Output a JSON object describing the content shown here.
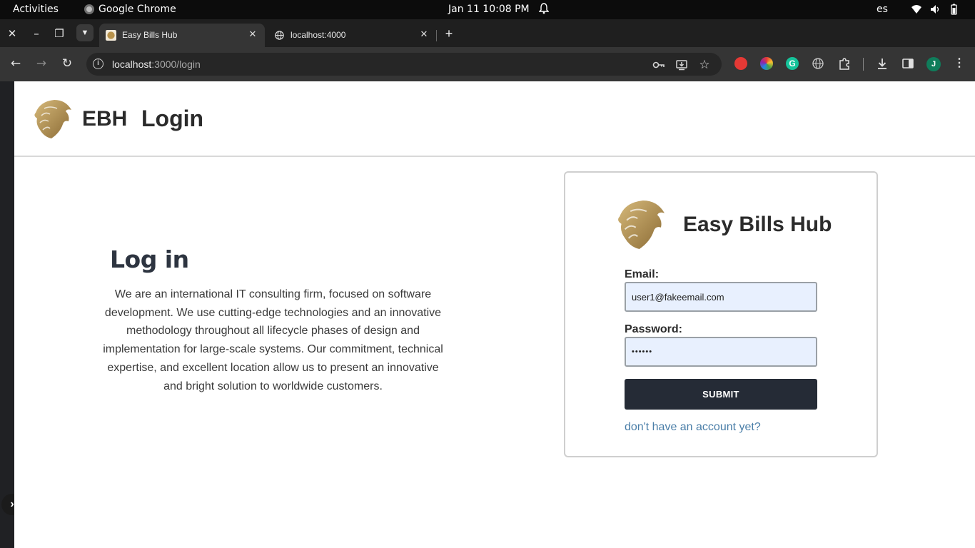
{
  "os": {
    "activities": "Activities",
    "app_name": "Google Chrome",
    "clock": "Jan 11  10:08 PM",
    "lang": "es",
    "tray_icons": [
      "wifi-icon",
      "volume-icon",
      "battery-icon"
    ]
  },
  "browser": {
    "tabs": [
      {
        "title": "Easy Bills Hub",
        "active": true,
        "favicon": "lion-favicon-icon"
      },
      {
        "title": "localhost:4000",
        "active": false,
        "favicon": "globe-icon"
      }
    ],
    "url_host": "localhost",
    "url_rest": ":3000/login",
    "toolbar_icons": [
      "back-icon",
      "forward-icon",
      "reload-icon",
      "key-icon",
      "install-icon",
      "star-icon",
      "download-icon",
      "side-panel-icon",
      "menu-icon"
    ],
    "extensions": [
      "adblock-extension-icon",
      "color-picker-extension-icon",
      "grammarly-extension-icon",
      "globe-extension-icon",
      "puzzle-extension-icon"
    ],
    "profile_initial": "J"
  },
  "header": {
    "brand": "EBH",
    "title": "Login"
  },
  "intro": {
    "title": "Log in",
    "text": "We are an international IT consulting firm, focused on software development. We use cutting-edge technologies and an innovative methodology throughout all lifecycle phases of design and implementation for large-scale systems. Our commitment, technical expertise, and excellent location allow us to present an innovative and bright solution to worldwide customers."
  },
  "login_card": {
    "title": "Easy Bills Hub",
    "email_label": "Email:",
    "email_value": "user1@fakeemail.com",
    "password_label": "Password:",
    "password_value": "••••••",
    "submit_label": "SUBMIT",
    "signup_link": "don't have an account yet?"
  },
  "colors": {
    "accent_dark": "#252b36",
    "link": "#4a7ea8",
    "autofill_bg": "#e8f0fe",
    "logo_gold": "#b8924a"
  }
}
